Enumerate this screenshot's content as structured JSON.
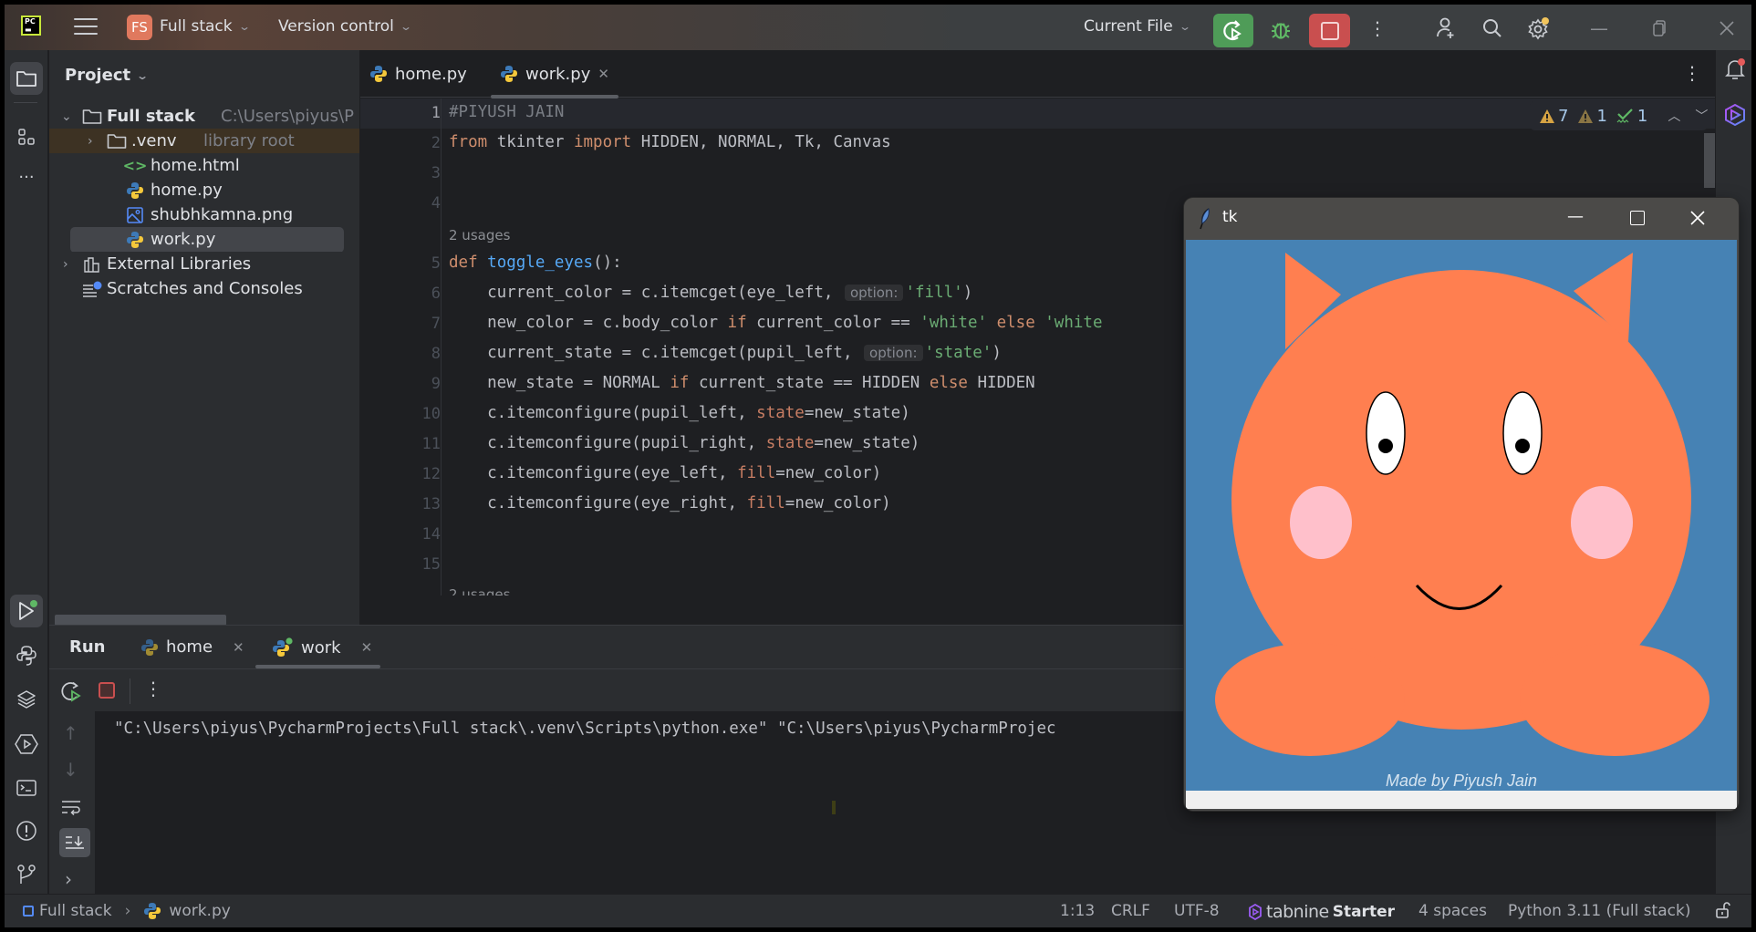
{
  "titlebar": {
    "logo_text": "PC",
    "project_badge": "FS",
    "project_name": "Full stack",
    "vcs_label": "Version control",
    "run_config": "Current File",
    "icons": [
      "hamburger-menu-icon",
      "rerun-icon",
      "debug-icon",
      "stop-icon",
      "more-vertical-icon",
      "code-with-me-icon",
      "search-icon",
      "settings-icon",
      "minimize-icon",
      "restore-icon",
      "close-icon"
    ]
  },
  "left_strip": {
    "icons": [
      "project-folder-icon",
      "structure-icon",
      "more-horizontal-icon",
      "run-tool-icon",
      "python-console-icon",
      "layers-icon",
      "services-icon",
      "terminal-icon",
      "problems-icon",
      "git-icon"
    ]
  },
  "project_panel": {
    "title": "Project",
    "tree": [
      {
        "label": "Full stack",
        "hint": "C:\\Users\\piyus\\P",
        "type": "folder",
        "expanded": true
      },
      {
        "label": ".venv",
        "hint": "library root",
        "type": "folder",
        "expanded": false
      },
      {
        "label": "home.html",
        "type": "html"
      },
      {
        "label": "home.py",
        "type": "python"
      },
      {
        "label": "shubhkamna.png",
        "type": "image"
      },
      {
        "label": "work.py",
        "type": "python",
        "selected": true
      },
      {
        "label": "External Libraries",
        "type": "library",
        "expanded": false
      },
      {
        "label": "Scratches and Consoles",
        "type": "scratches"
      }
    ]
  },
  "editor": {
    "tabs": [
      {
        "label": "home.py",
        "active": false
      },
      {
        "label": "work.py",
        "active": true
      }
    ],
    "inspections": {
      "warnings": "7",
      "weak_warnings": "1",
      "typos": "1"
    },
    "usages_label": "2 usages",
    "hint_option": "option:",
    "line_numbers": [
      "1",
      "2",
      "3",
      "4",
      "5",
      "6",
      "7",
      "8",
      "9",
      "10",
      "11",
      "12",
      "13",
      "14",
      "15"
    ],
    "lines": {
      "l1": "#PIYUSH JAIN",
      "l2_kw1": "from",
      "l2_mod": " tkinter ",
      "l2_kw2": "import",
      "l2_rest": " HIDDEN, NORMAL, Tk, Canvas",
      "l5_kw": "def",
      "l5_fn": "toggle_eyes",
      "l5_rest": "():",
      "l6_a": "    current_color = c.itemcget(eye_left, ",
      "l6_str": "'fill'",
      "l6_b": ")",
      "l7_a": "    new_color = c.body_color ",
      "l7_kw1": "if",
      "l7_b": " current_color == ",
      "l7_str1": "'white'",
      "l7_kw2": " else ",
      "l7_str2": "'white",
      "l8_a": "    current_state = c.itemcget(pupil_left, ",
      "l8_str": "'state'",
      "l8_b": ")",
      "l9_a": "    new_state = NORMAL ",
      "l9_kw1": "if",
      "l9_b": " current_state == HIDDEN ",
      "l9_kw2": "else",
      "l9_c": " HIDDEN",
      "l10_a": "    c.itemconfigure(pupil_left, ",
      "l10_p": "state",
      "l10_b": "=new_state)",
      "l11_a": "    c.itemconfigure(pupil_right, ",
      "l11_p": "state",
      "l11_b": "=new_state)",
      "l12_a": "    c.itemconfigure(eye_left, ",
      "l12_p": "fill",
      "l12_b": "=new_color)",
      "l13_a": "    c.itemconfigure(eye_right, ",
      "l13_p": "fill",
      "l13_b": "=new_color)"
    }
  },
  "right_strip": {
    "icons": [
      "notifications-icon",
      "tabnine-icon"
    ]
  },
  "run_panel": {
    "title": "Run",
    "tabs": [
      {
        "label": "home",
        "active": false
      },
      {
        "label": "work",
        "active": true
      }
    ],
    "console_output": "\"C:\\Users\\piyus\\PycharmProjects\\Full stack\\.venv\\Scripts\\python.exe\" \"C:\\Users\\piyus\\PycharmProjec"
  },
  "statusbar": {
    "breadcrumb": [
      "Full stack",
      "work.py"
    ],
    "position": "1:13",
    "line_separator": "CRLF",
    "encoding": "UTF-8",
    "tabnine_brand": "tabnine",
    "tabnine_plan": "Starter",
    "indent": "4 spaces",
    "interpreter": "Python 3.11 (Full stack)"
  },
  "tk_window": {
    "title": "tk",
    "caption": "Made by Piyush Jain",
    "colors": {
      "background": "#4682b4",
      "body": "#ff7f50",
      "cheeks": "#ffc0cb",
      "eyes": "#ffffff",
      "pupils": "#000000"
    }
  },
  "colors": {
    "run_green": "#4f9c58",
    "stop_red": "#c94f4f",
    "keyword": "#cf8e6d",
    "function": "#56a8f5",
    "string": "#6aab73"
  }
}
